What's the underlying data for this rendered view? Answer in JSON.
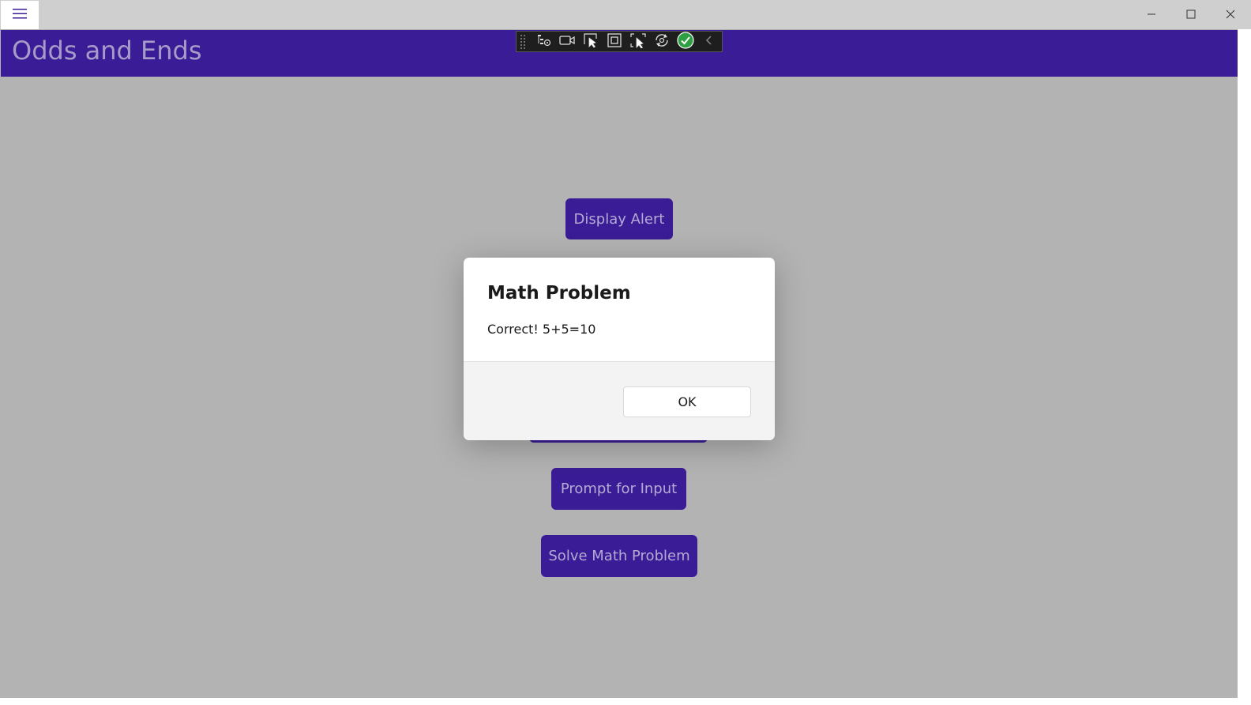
{
  "window": {
    "menu_icon": "hamburger-icon",
    "controls": [
      "minimize-icon",
      "maximize-icon",
      "close-icon"
    ]
  },
  "app": {
    "title": "Odds and Ends",
    "header_color": "#3a1d96"
  },
  "debug_toolbar": {
    "icons": [
      "live-visual-tree-icon",
      "video-camera-icon",
      "select-element-icon",
      "display-layout-adorners-icon",
      "track-focus-icon",
      "hot-reload-icon",
      "check-icon",
      "collapse-chevron-icon"
    ]
  },
  "buttons": {
    "display_alert": "Display Alert",
    "prompt_for_input": "Prompt for Input",
    "solve_math_problem": "Solve Math Problem"
  },
  "dialog": {
    "title": "Math Problem",
    "message": "Correct! 5+5=10",
    "ok_label": "OK"
  }
}
